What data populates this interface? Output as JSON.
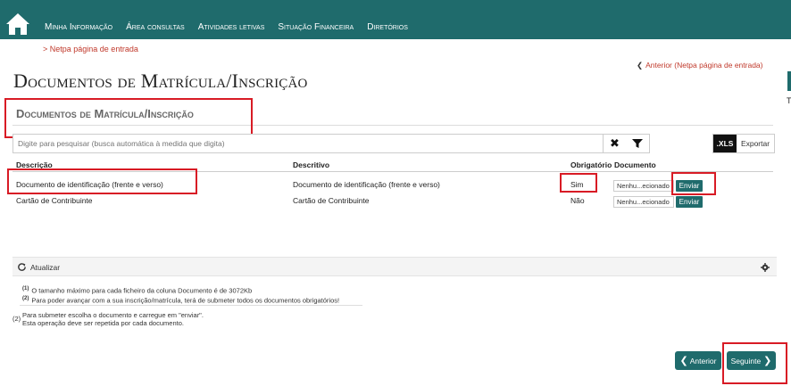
{
  "nav": {
    "items": [
      "Minha Informação",
      "Área consultas",
      "Atividades letivas",
      "Situação Financeira",
      "Diretórios"
    ]
  },
  "breadcrumb": "> Netpa página de entrada",
  "back_link": "Anterior (Netpa página de entrada)",
  "page_title": "Documentos de Matrícula/Inscrição",
  "section_title": "Documentos de Matrícula/Inscrição",
  "search": {
    "placeholder": "Digite para pesquisar (busca automática à medida que digita)"
  },
  "export": {
    "xls_label": ".XLS",
    "export_label": "Exportar"
  },
  "table": {
    "headers": [
      "Descrição",
      "Descritivo",
      "Obrigatório",
      "Documento"
    ],
    "rows": [
      {
        "descricao": "Documento de identificação (frente e verso)",
        "descritivo": "Documento de identificação (frente e verso)",
        "obrigatorio": "Sim",
        "file": "Nenhu...ecionado",
        "action": "Enviar"
      },
      {
        "descricao": "Cartão de Contribuinte",
        "descritivo": "Cartão de Contribuinte",
        "obrigatorio": "Não",
        "file": "Nenhu...ecionado",
        "action": "Enviar"
      }
    ]
  },
  "refresh_label": "Atualizar",
  "notes": {
    "n1_num": "(1)",
    "n1": "O tamanho máximo para cada ficheiro da coluna Documento é de 3072Kb",
    "n2_num": "(2)",
    "n2": "Para poder avançar com a sua inscrição/matrícula, terá de submeter todos os documentos obrigatórios!",
    "n3_num": "(2)",
    "n3a": "Para submeter escolha o documento e carregue em \"enviar\".",
    "n3b": "Esta operação deve ser repetida por cada documento."
  },
  "buttons": {
    "previous": "Anterior",
    "next": "Seguinte"
  },
  "colors": {
    "primary": "#1f6b6c",
    "highlight": "#d81b25",
    "link": "#c0392b"
  }
}
